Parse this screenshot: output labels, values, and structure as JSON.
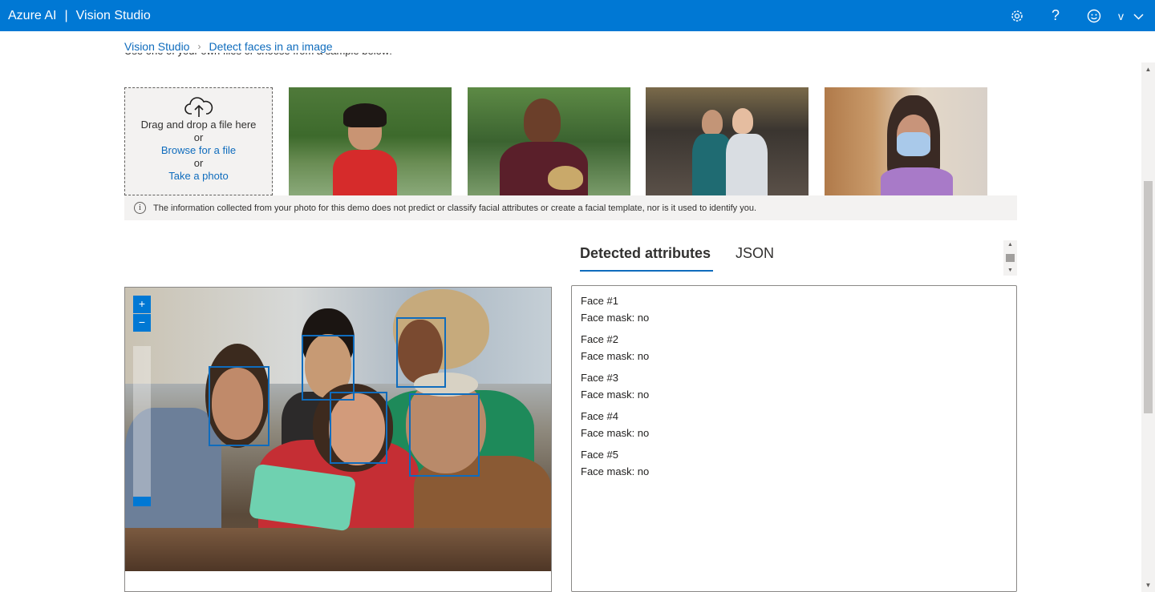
{
  "header": {
    "brand": "Azure AI",
    "product": "Vision Studio",
    "account_initial": "v",
    "icons": [
      "gear-icon",
      "help-icon",
      "feedback-smiley-icon",
      "chevron-down-icon"
    ]
  },
  "breadcrumb": {
    "items": [
      "Vision Studio",
      "Detect faces in an image"
    ]
  },
  "intro_text_cut": "Use one of your own files or choose from a sample below:",
  "upload": {
    "drag_text": "Drag and drop a file here",
    "or1": "or",
    "browse_link": "Browse for a file",
    "or2": "or",
    "photo_link": "Take a photo"
  },
  "samples": [
    "sample-woman-red-dress",
    "sample-man-holding-mask",
    "sample-two-women-office",
    "sample-woman-face-mask"
  ],
  "info_notice": "The information collected from your photo for this demo does not predict or classify facial attributes or create a facial template, nor is it used to identify you.",
  "tabs": [
    "Detected attributes",
    "JSON"
  ],
  "active_tab": "Detected attributes",
  "zoom": {
    "in_label": "+",
    "out_label": "−"
  },
  "faces": [
    {
      "title": "Face #1",
      "mask": "Face mask: no"
    },
    {
      "title": "Face #2",
      "mask": "Face mask: no"
    },
    {
      "title": "Face #3",
      "mask": "Face mask: no"
    },
    {
      "title": "Face #4",
      "mask": "Face mask: no"
    },
    {
      "title": "Face #5",
      "mask": "Face mask: no"
    }
  ],
  "colors": {
    "brand_blue": "#0078d4",
    "link_blue": "#0f6cbd",
    "facebox_blue": "#0f6cbd"
  }
}
